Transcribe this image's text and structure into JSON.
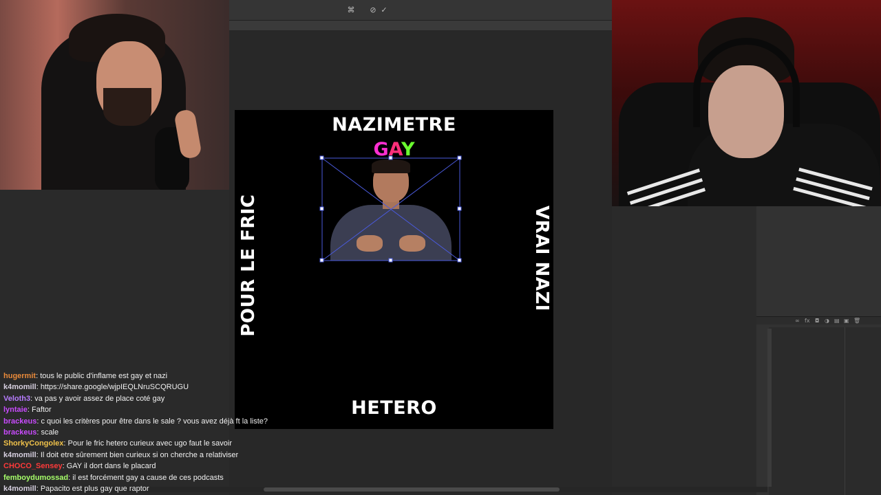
{
  "canvas": {
    "title_top": "NAZIMETRE",
    "subtitle_letters": [
      "G",
      "A",
      "Y"
    ],
    "label_left": "POUR LE FRIC",
    "label_right": "VRAI NAZI",
    "label_bottom": "HETERO"
  },
  "icons": {
    "options_bar": [
      "warp-icon",
      "cancel-transform-icon",
      "commit-transform-icon"
    ],
    "options_bar_glyphs": [
      "⌘",
      "⊘",
      "✓"
    ],
    "layers_footer": [
      "link-icon",
      "fx-icon",
      "mask-icon",
      "adjustment-icon",
      "folder-icon",
      "new-layer-icon",
      "trash-icon"
    ],
    "layers_footer_glyphs": [
      "∞",
      "fx",
      "◘",
      "◑",
      "▤",
      "▣",
      "🗑"
    ]
  },
  "colors": {
    "gay_g": "#ff2fd1",
    "gay_a": "#ff2f7a",
    "gay_y": "#6bff2f",
    "transform_box": "#4a5adb"
  },
  "chat": [
    {
      "user": "hugermit",
      "color": "#e98a3a",
      "text": "tous le public d'inflame est gay et nazi"
    },
    {
      "user": "k4momill",
      "color": "#d7d0e0",
      "text": "https://share.google/wjpIEQLNruSCQRUGU"
    },
    {
      "user": "Veloth3",
      "color": "#b77cff",
      "text": "va pas y avoir assez de place coté gay"
    },
    {
      "user": "lyntaie",
      "color": "#c94bff",
      "text": "Faftor"
    },
    {
      "user": "brackeus",
      "color": "#c94bff",
      "text": "c quoi les critères pour être dans le sale ? vous avez déjà ft la liste?"
    },
    {
      "user": "brackeus",
      "color": "#c94bff",
      "text": "scale"
    },
    {
      "user": "ShorkyCongolex",
      "color": "#f0c24a",
      "text": "Pour le fric hetero curieux avec ugo faut le savoir"
    },
    {
      "user": "k4momill",
      "color": "#d7d0e0",
      "text": "Il doit etre sûrement bien curieux si on cherche a relativiser"
    },
    {
      "user": "CHOCO_Sensey",
      "color": "#ff3a3a",
      "text": "GAY il dort dans le placard"
    },
    {
      "user": "femboydumossad",
      "color": "#a7ff6a",
      "text": "il est forcément gay a cause de ces podcasts"
    },
    {
      "user": "k4momill",
      "color": "#d7d0e0",
      "text": "Papacito est plus gay que raptor"
    }
  ]
}
